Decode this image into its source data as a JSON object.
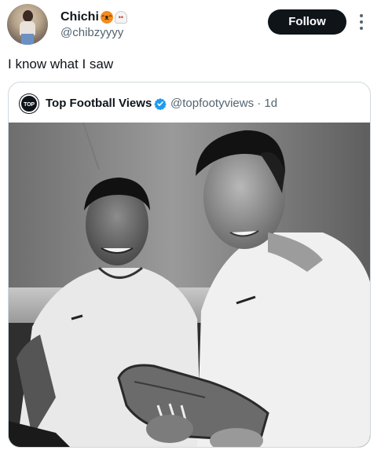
{
  "post": {
    "author": {
      "display_name": "Chichi",
      "handle": "@chibzyyyy"
    },
    "follow_label": "Follow",
    "text": "I know what I saw"
  },
  "quote": {
    "author": {
      "display_name": "Top Football Views",
      "handle_time": "@topfootyviews · 1d",
      "avatar_text": "TOP"
    }
  },
  "icons": {
    "emoji_1": "jack-o-lantern-icon",
    "emoji_2": "ghost-icon",
    "verified": "verified-badge-icon",
    "more": "more-options-icon"
  },
  "colors": {
    "follow_bg": "#0f1419",
    "verified": "#1d9bf0",
    "secondary_text": "#536471"
  }
}
